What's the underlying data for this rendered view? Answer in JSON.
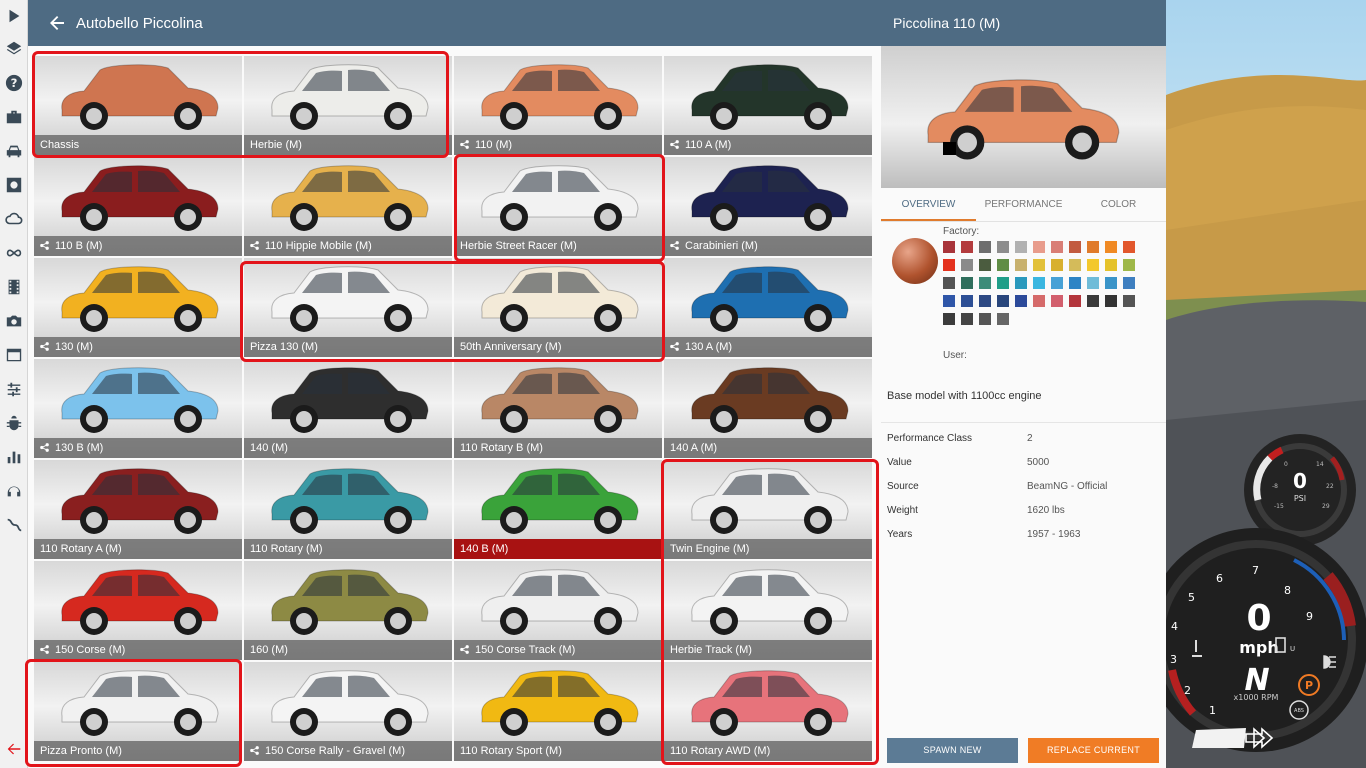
{
  "header": {
    "title": "Autobello Piccolina"
  },
  "grid": {
    "tiles": [
      {
        "label": "Chassis",
        "config": false,
        "color": "#cf7550",
        "selected": false
      },
      {
        "label": "Herbie (M)",
        "config": false,
        "color": "#ededea",
        "selected": false
      },
      {
        "label": "110 (M)",
        "config": true,
        "color": "#e38b60",
        "selected": false
      },
      {
        "label": "110 A (M)",
        "config": true,
        "color": "#23352a",
        "selected": false
      },
      {
        "label": "110 B (M)",
        "config": true,
        "color": "#8a1d1e",
        "selected": false
      },
      {
        "label": "110 Hippie Mobile (M)",
        "config": true,
        "color": "#e6b14c",
        "selected": false
      },
      {
        "label": "Herbie Street Racer (M)",
        "config": false,
        "color": "#f2f2f2",
        "selected": false
      },
      {
        "label": "Carabinieri (M)",
        "config": true,
        "color": "#1d2250",
        "selected": false
      },
      {
        "label": "130 (M)",
        "config": true,
        "color": "#f2b120",
        "selected": false
      },
      {
        "label": "Pizza 130 (M)",
        "config": false,
        "color": "#f4f4f4",
        "selected": false
      },
      {
        "label": "50th Anniversary (M)",
        "config": false,
        "color": "#f3ead8",
        "selected": false
      },
      {
        "label": "130 A (M)",
        "config": true,
        "color": "#1e6fb1",
        "selected": false
      },
      {
        "label": "130 B (M)",
        "config": true,
        "color": "#7cc2ec",
        "selected": false
      },
      {
        "label": "140 (M)",
        "config": false,
        "color": "#2e2e2e",
        "selected": false
      },
      {
        "label": "110 Rotary B (M)",
        "config": false,
        "color": "#b98766",
        "selected": false
      },
      {
        "label": "140 A (M)",
        "config": false,
        "color": "#6a3b22",
        "selected": false
      },
      {
        "label": "110 Rotary A (M)",
        "config": false,
        "color": "#8a1f1f",
        "selected": false
      },
      {
        "label": "110 Rotary (M)",
        "config": false,
        "color": "#3a9aa5",
        "selected": false
      },
      {
        "label": "140 B (M)",
        "config": false,
        "color": "#3aa33a",
        "selected": true
      },
      {
        "label": "Twin Engine (M)",
        "config": false,
        "color": "#efefef",
        "selected": false
      },
      {
        "label": "150 Corse (M)",
        "config": true,
        "color": "#d6291f",
        "selected": false
      },
      {
        "label": "160 (M)",
        "config": false,
        "color": "#8d8a44",
        "selected": false
      },
      {
        "label": "150 Corse Track (M)",
        "config": true,
        "color": "#efefef",
        "selected": false
      },
      {
        "label": "Herbie Track (M)",
        "config": false,
        "color": "#f3f3f3",
        "selected": false
      },
      {
        "label": "Pizza Pronto (M)",
        "config": false,
        "color": "#f1f1f1",
        "selected": false
      },
      {
        "label": "150 Corse Rally - Gravel (M)",
        "config": true,
        "color": "#f4f4f4",
        "selected": false
      },
      {
        "label": "110 Rotary Sport (M)",
        "config": false,
        "color": "#f1b912",
        "selected": false
      },
      {
        "label": "110 Rotary AWD (M)",
        "config": false,
        "color": "#e7737b",
        "selected": false
      }
    ]
  },
  "detail": {
    "title": "Piccolina 110 (M)",
    "car_color": "#e38b60",
    "tabs": [
      "OVERVIEW",
      "PERFORMANCE",
      "COLOR"
    ],
    "active_tab": "OVERVIEW",
    "factory_label": "Factory:",
    "user_label": "User:",
    "swatches": [
      "#a8343a",
      "#b33b3d",
      "#6e6e6e",
      "#8d8d8d",
      "#b1b1b1",
      "#e89c8c",
      "#d97e76",
      "#c25b3f",
      "#e07b2b",
      "#f08a24",
      "#e2572c",
      "#e4321e",
      "#8a8a8a",
      "#4b5c3f",
      "#5f8d45",
      "#c8b16e",
      "#e2c13a",
      "#d8b02e",
      "#d4bb5a",
      "#f3c82c",
      "#e5c22a",
      "#9fb849",
      "#545454",
      "#2f6e5c",
      "#3c8c79",
      "#1f9e88",
      "#2a99bd",
      "#3ab6e0",
      "#47a1d6",
      "#2d84c5",
      "#6fbcd8",
      "#3a94c8",
      "#3e7fc0",
      "#2f56a8",
      "#2d4f95",
      "#2d4983",
      "#29467c",
      "#2c4a9a",
      "#d56a6a",
      "#d25f6d",
      "#b3353c",
      "#3a3a3a",
      "#333333",
      "#545454",
      "#3b3b3b",
      "#444444",
      "#555555",
      "#666666"
    ],
    "description": "Base model with 1100cc engine",
    "stats": [
      {
        "key": "Performance Class",
        "value": "2"
      },
      {
        "key": "Value",
        "value": "5000"
      },
      {
        "key": "Source",
        "value": "BeamNG - Official"
      },
      {
        "key": "Weight",
        "value": "1620 lbs"
      },
      {
        "key": "Years",
        "value": "1957 - 1963"
      }
    ],
    "spawn_label": "SPAWN NEW",
    "replace_label": "REPLACE CURRENT"
  },
  "hud": {
    "boost_psi": "0",
    "boost_unit": "PSI",
    "boost_ticks": [
      "-8",
      "0",
      "14",
      "22",
      "29",
      "-15"
    ],
    "speed": "0",
    "speed_unit": "mph",
    "gear": "N",
    "rpm_label": "x1000 RPM",
    "rpm_ticks": [
      "1",
      "2",
      "3",
      "4",
      "5",
      "6",
      "7",
      "8",
      "9"
    ],
    "parking_brake": "P",
    "abs": "ABS",
    "fuel_mark": "U"
  }
}
